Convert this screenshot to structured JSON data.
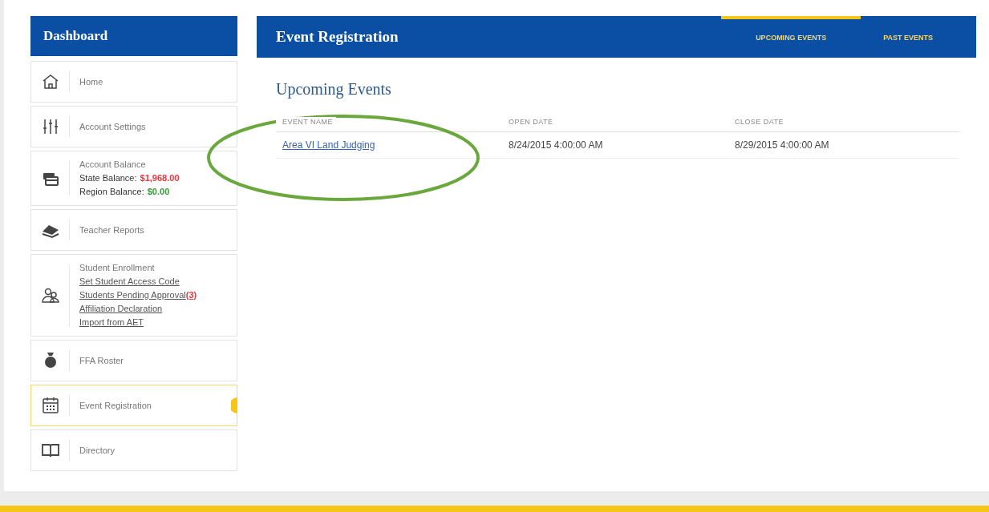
{
  "sidebar": {
    "title": "Dashboard",
    "items": [
      {
        "kind": "simple",
        "label": "Home",
        "selected": false
      },
      {
        "kind": "simple",
        "label": "Account Settings",
        "selected": false
      },
      {
        "kind": "balance",
        "label": "Account Balance",
        "selected": false,
        "lines": [
          {
            "label": "State Balance:",
            "value": "$1,968.00",
            "color": "#e8383d"
          },
          {
            "label": "Region Balance:",
            "value": "$0.00",
            "color": "#3a9a3a"
          }
        ]
      },
      {
        "kind": "simple",
        "label": "Teacher Reports",
        "selected": false
      },
      {
        "kind": "links",
        "label": "Student Enrollment",
        "selected": false,
        "links": [
          {
            "text": "Set Student Access Code"
          },
          {
            "text": "Students Pending Approval",
            "badge": "(3)"
          },
          {
            "text": "Affiliation Declaration"
          },
          {
            "text": "Import from AET"
          }
        ]
      },
      {
        "kind": "simple",
        "label": "FFA Roster",
        "selected": false
      },
      {
        "kind": "simple",
        "label": "Event Registration",
        "selected": true
      },
      {
        "kind": "simple",
        "label": "Directory",
        "selected": false
      }
    ]
  },
  "header": {
    "title": "Event Registration",
    "tabs": [
      {
        "label": "UPCOMING EVENTS",
        "selected": true
      },
      {
        "label": "PAST EVENTS",
        "selected": false
      }
    ]
  },
  "section_title": "Upcoming Events",
  "table": {
    "columns": [
      "EVENT NAME",
      "OPEN DATE",
      "CLOSE DATE"
    ],
    "rows": [
      [
        "Area VI Land Judging",
        "8/24/2015 4:00:00 AM",
        "8/29/2015 4:00:00 AM"
      ]
    ]
  }
}
